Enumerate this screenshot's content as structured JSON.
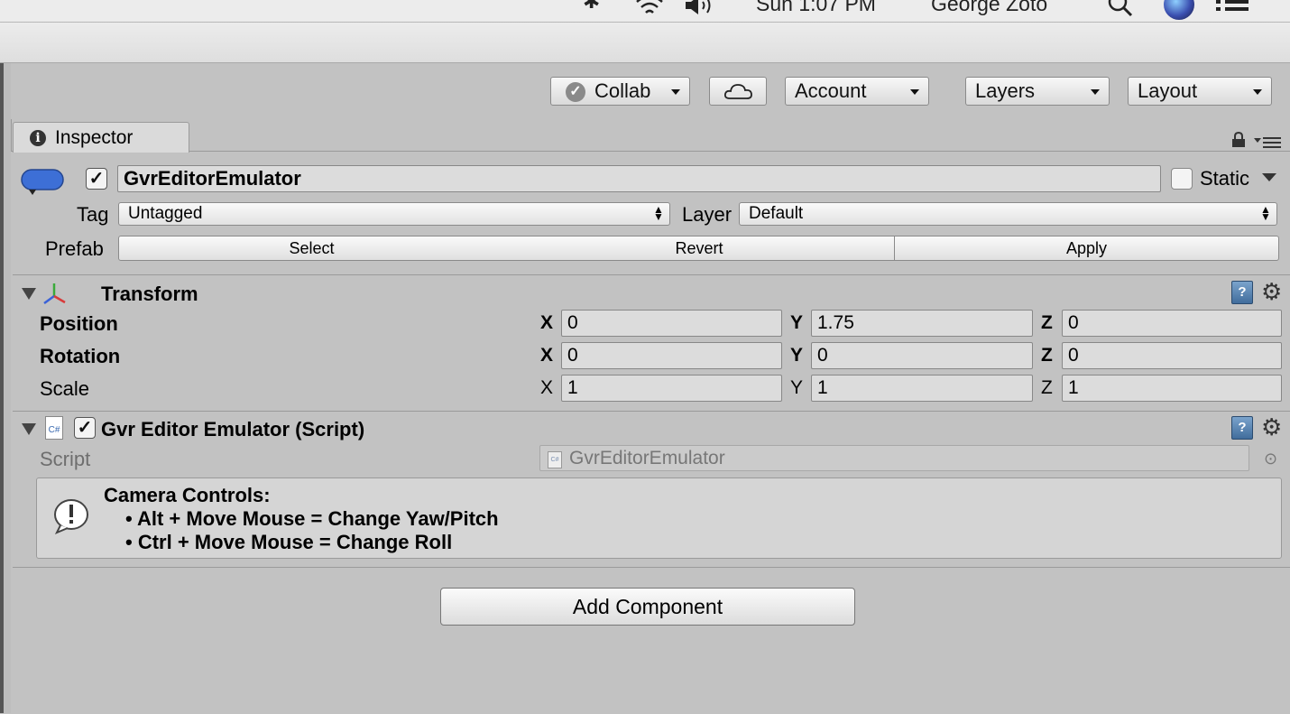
{
  "menubar": {
    "clock": "Sun 1:07 PM",
    "user": "George Zoto",
    "icons": [
      "bluetooth-icon",
      "wifi-icon",
      "volume-icon",
      "search-icon",
      "siri-icon",
      "notification-list-icon"
    ]
  },
  "toolbar": {
    "collab_label": "Collab",
    "account_label": "Account",
    "layers_label": "Layers",
    "layout_label": "Layout"
  },
  "tab": {
    "label": "Inspector"
  },
  "gameobject": {
    "name": "GvrEditorEmulator",
    "active": true,
    "static_label": "Static",
    "static_checked": false,
    "tag_label": "Tag",
    "tag_value": "Untagged",
    "layer_label": "Layer",
    "layer_value": "Default",
    "prefab_label": "Prefab",
    "prefab_buttons": [
      "Select",
      "Revert",
      "Apply"
    ]
  },
  "transform": {
    "title": "Transform",
    "rows": [
      {
        "label": "Position",
        "x": "0",
        "y": "1.75",
        "z": "0"
      },
      {
        "label": "Rotation",
        "x": "0",
        "y": "0",
        "z": "0"
      },
      {
        "label": "Scale",
        "x": "1",
        "y": "1",
        "z": "1"
      }
    ],
    "axis_labels": [
      "X",
      "Y",
      "Z"
    ]
  },
  "script_component": {
    "title": "Gvr Editor Emulator (Script)",
    "enabled": true,
    "script_label": "Script",
    "script_value": "GvrEditorEmulator",
    "help": {
      "heading": "Camera Controls:",
      "lines": [
        "• Alt + Move Mouse = Change Yaw/Pitch",
        "• Ctrl + Move Mouse = Change Roll"
      ]
    }
  },
  "add_component_label": "Add Component",
  "colors": {
    "panel_bg": "#c2c2c2",
    "field_bg": "#dcdcdc",
    "help_icon": "#416d9c",
    "gameobject_icon": "#3d6fd6"
  }
}
